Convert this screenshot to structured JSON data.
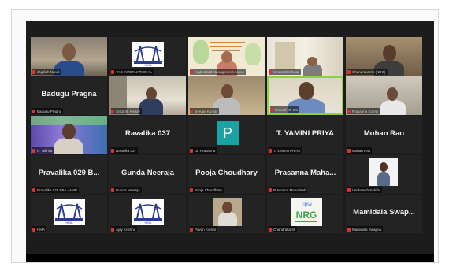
{
  "meeting": {
    "tiles": [
      {
        "display_name": "",
        "caption": "Jagdish Nandi"
      },
      {
        "display_name": "",
        "caption": "TAG INTERNATIONAL"
      },
      {
        "display_name": "",
        "caption": "Hyderabad Management Assoc"
      },
      {
        "display_name": "",
        "caption": "Umamaheshwar"
      },
      {
        "display_name": "",
        "caption": "Chandrakanth (NRG)"
      },
      {
        "display_name": "Badugu Pragna",
        "caption": "Badugu Pragna"
      },
      {
        "display_name": "",
        "caption": "Srikanth Reddy"
      },
      {
        "display_name": "",
        "caption": "Jeevan Kumar"
      },
      {
        "display_name": "",
        "caption": "Prasad Ch Sm"
      },
      {
        "display_name": "",
        "caption": "Prasanna Kumar"
      },
      {
        "display_name": "",
        "caption": "R. Nikhila"
      },
      {
        "display_name": "Ravalika 037",
        "caption": "Ravalika 037"
      },
      {
        "display_name": "",
        "avatar_letter": "P",
        "caption": "Dr. Prasanna"
      },
      {
        "display_name": "T. YAMINI PRIYA",
        "caption": "T. YAMINI PRIYA"
      },
      {
        "display_name": "Mohan Rao",
        "caption": "Mohan Rao"
      },
      {
        "display_name": "Pravalika 029 B...",
        "caption": "Pravalika 029 BBA - AMB"
      },
      {
        "display_name": "Gunda Neeraja",
        "caption": "Gunda Neeraja"
      },
      {
        "display_name": "Pooja Choudhary",
        "caption": "Pooja Choudhary"
      },
      {
        "display_name": "Prasanna Maha...",
        "caption": "Prasanna Mahankali"
      },
      {
        "display_name": "",
        "caption": "Venkatesh Sahithi"
      },
      {
        "display_name": "",
        "caption": "HMA"
      },
      {
        "display_name": "",
        "caption": "Ajay Krishna"
      },
      {
        "display_name": "",
        "caption": "Pavan Kumar"
      },
      {
        "display_name": "",
        "caption": "Chandrakanth"
      },
      {
        "display_name": "Mamidala Swap...",
        "caption": "Mamidala Swapna"
      }
    ],
    "logos": {
      "hma_text": "HMA",
      "nrg_text": "NRG",
      "tagline": "Tipsy"
    },
    "colors": {
      "active_border": "#8fd13a",
      "mic_muted": "#e03030",
      "tile_bg": "#232323",
      "avatar_bg": "#1aa3a3"
    }
  }
}
